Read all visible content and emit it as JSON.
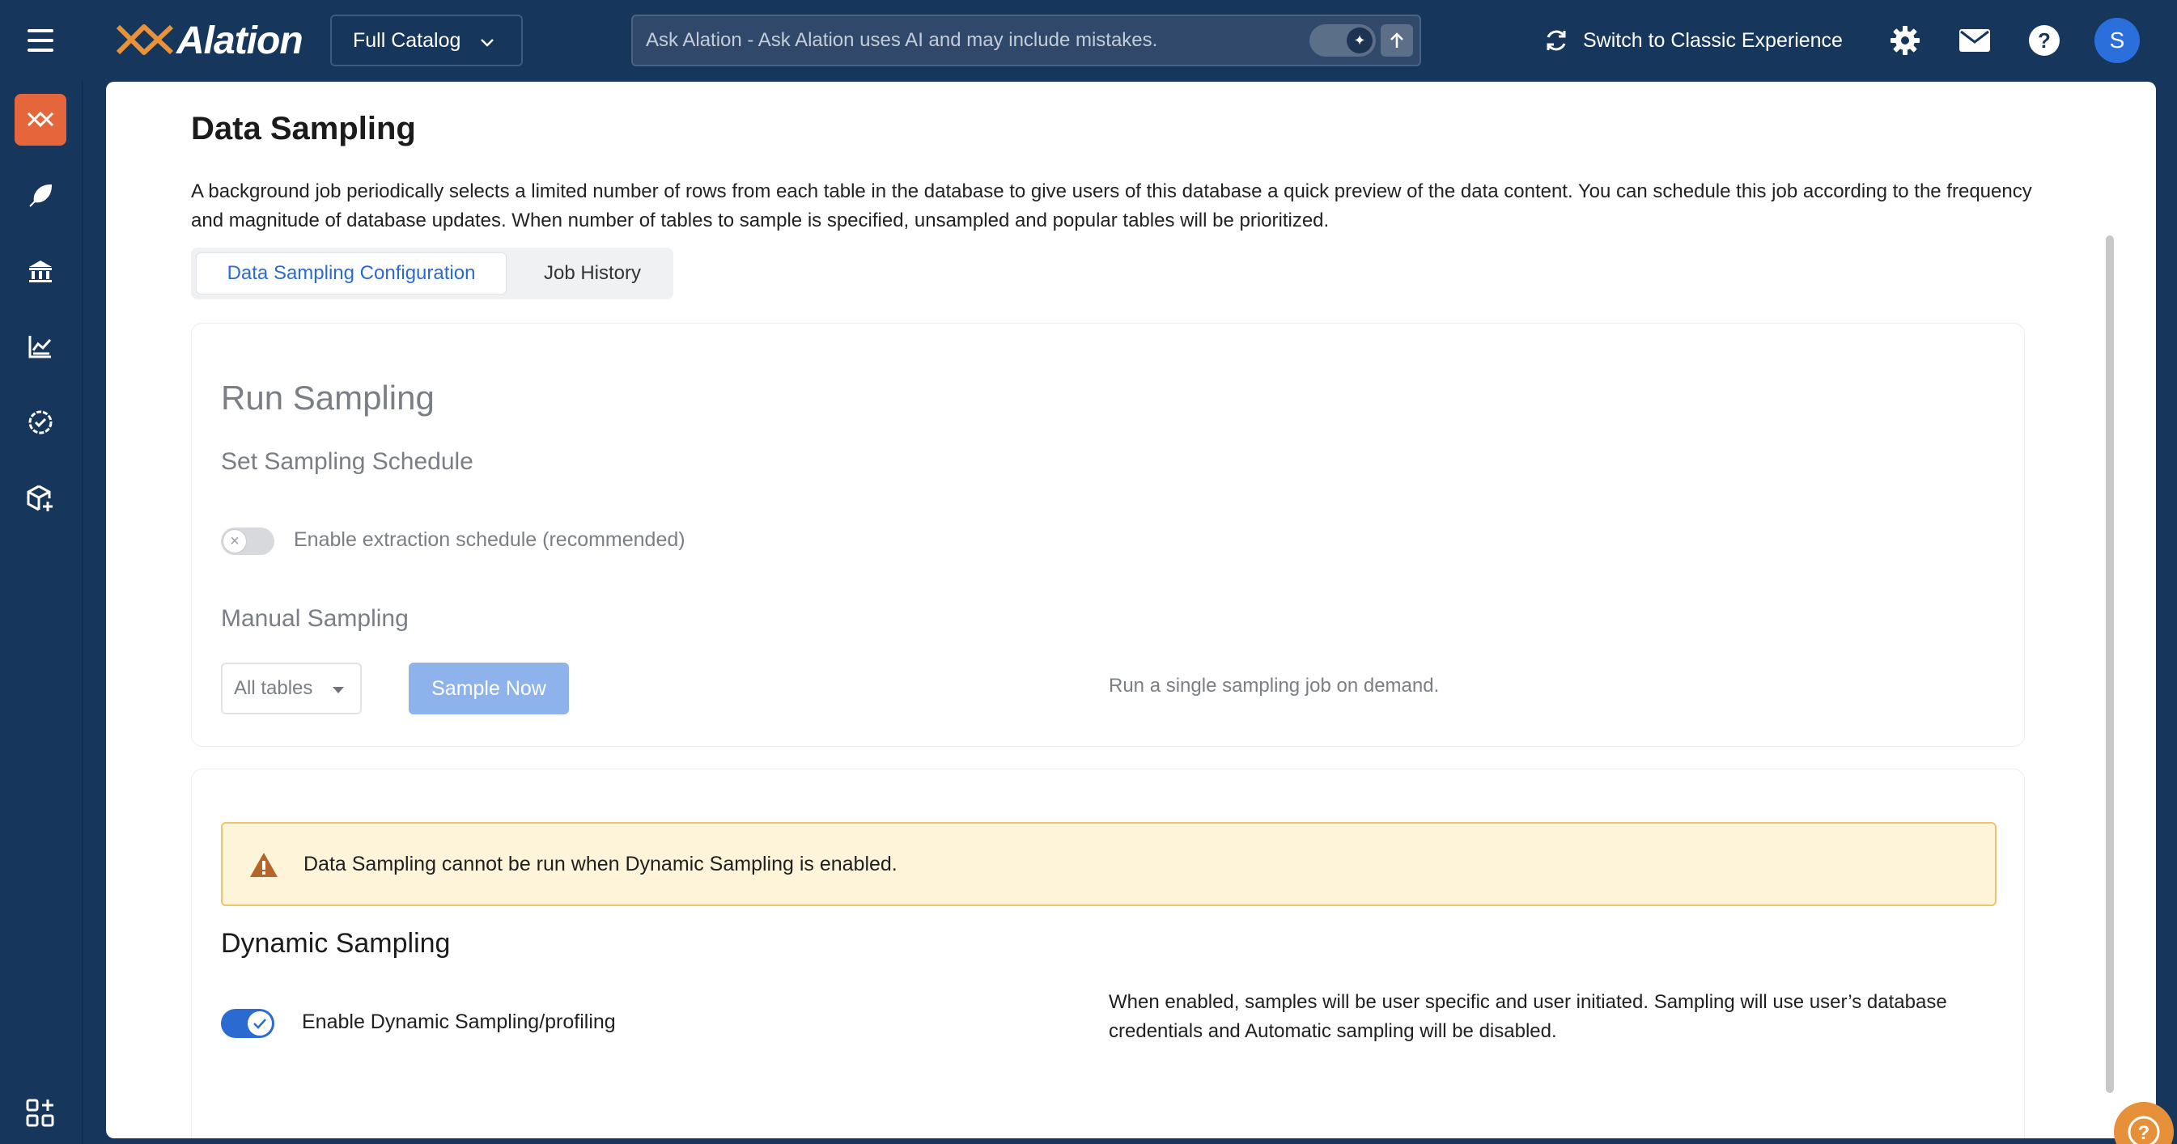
{
  "topbar": {
    "brand": "Alation",
    "catalog_label": "Full Catalog",
    "search_placeholder": "Ask Alation - Ask Alation uses AI and may include mistakes.",
    "classic_label": "Switch to Classic Experience",
    "avatar_initial": "S"
  },
  "page": {
    "title": "Data Sampling",
    "description": "A background job periodically selects a limited number of rows from each table in the database to give users of this database a quick preview of the data content. You can schedule this job according to the frequency and magnitude of database updates. When number of tables to sample is specified, unsampled and popular tables will be prioritized.",
    "tabs": [
      {
        "label": "Data Sampling Configuration",
        "active": true
      },
      {
        "label": "Job History",
        "active": false
      }
    ]
  },
  "run_sampling": {
    "title": "Run Sampling",
    "schedule_title": "Set Sampling Schedule",
    "schedule_toggle_label": "Enable extraction schedule (recommended)",
    "schedule_enabled": false,
    "manual_title": "Manual Sampling",
    "table_select_value": "All tables",
    "sample_button": "Sample Now",
    "manual_help": "Run a single sampling job on demand."
  },
  "dynamic_sampling": {
    "warning": "Data Sampling cannot be run when Dynamic Sampling is enabled.",
    "title": "Dynamic Sampling",
    "toggle_label": "Enable Dynamic Sampling/profiling",
    "enabled": true,
    "help": "When enabled, samples will be user specific and user initiated. Sampling will use user’s database credentials and Automatic sampling will be disabled."
  },
  "colors": {
    "navy": "#16365c",
    "accent_orange": "#e5663a",
    "primary_blue": "#2b6bd1",
    "warning_bg": "#fdf4d9"
  }
}
